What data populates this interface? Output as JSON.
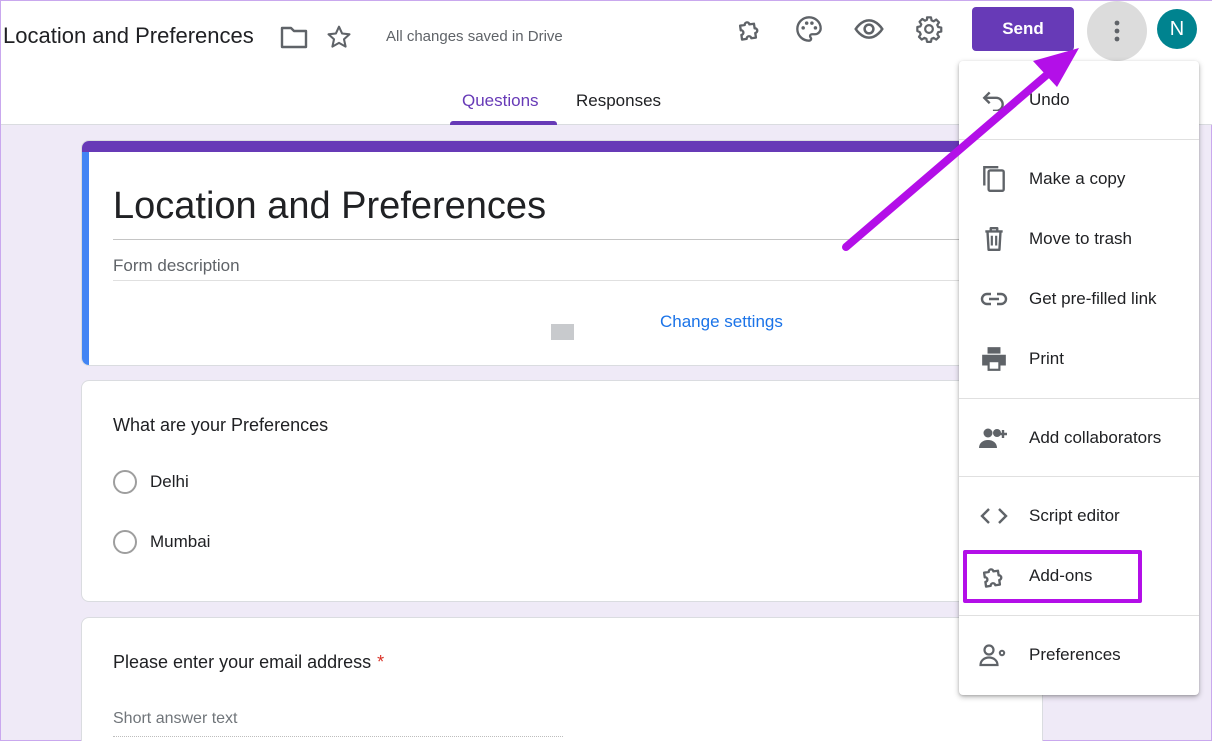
{
  "header": {
    "doc_title": "Location and Preferences",
    "save_status": "All changes saved in Drive",
    "send_label": "Send",
    "avatar_letter": "N",
    "tabs": [
      {
        "label": "Questions",
        "active": true
      },
      {
        "label": "Responses",
        "active": false
      }
    ]
  },
  "form": {
    "title": "Location and Preferences",
    "description_placeholder": "Form description",
    "change_settings": "Change settings"
  },
  "question1": {
    "title": "What are your Preferences",
    "options": [
      "Delhi",
      "Mumbai"
    ]
  },
  "question2": {
    "title": "Please enter your email address",
    "required_mark": "*",
    "placeholder": "Short answer text"
  },
  "menu": {
    "items": [
      {
        "label": "Undo",
        "icon": "undo-icon"
      },
      {
        "label": "Make a copy",
        "icon": "copy-icon"
      },
      {
        "label": "Move to trash",
        "icon": "trash-icon"
      },
      {
        "label": "Get pre-filled link",
        "icon": "link-icon"
      },
      {
        "label": "Print",
        "icon": "print-icon"
      },
      {
        "label": "Add collaborators",
        "icon": "add-collaborators-icon"
      },
      {
        "label": "Script editor",
        "icon": "code-icon"
      },
      {
        "label": "Add-ons",
        "icon": "puzzle-icon"
      },
      {
        "label": "Preferences",
        "icon": "preferences-icon"
      }
    ]
  },
  "colors": {
    "accent": "#673ab7",
    "annotation": "#b30fe8",
    "avatar": "#00838f",
    "link": "#1a73e8"
  }
}
